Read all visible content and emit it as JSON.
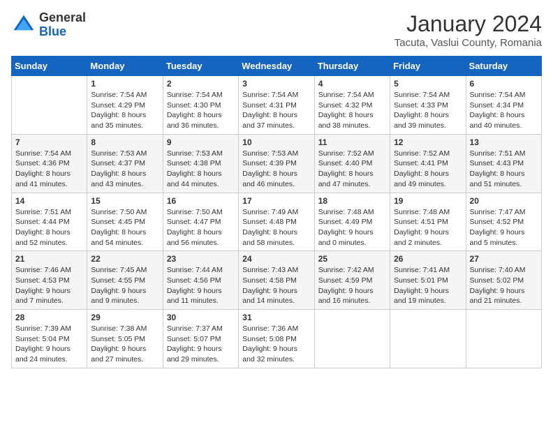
{
  "header": {
    "logo_general": "General",
    "logo_blue": "Blue",
    "month_title": "January 2024",
    "location": "Tacuta, Vaslui County, Romania"
  },
  "days_of_week": [
    "Sunday",
    "Monday",
    "Tuesday",
    "Wednesday",
    "Thursday",
    "Friday",
    "Saturday"
  ],
  "weeks": [
    [
      {
        "day": "",
        "detail": ""
      },
      {
        "day": "1",
        "detail": "Sunrise: 7:54 AM\nSunset: 4:29 PM\nDaylight: 8 hours\nand 35 minutes."
      },
      {
        "day": "2",
        "detail": "Sunrise: 7:54 AM\nSunset: 4:30 PM\nDaylight: 8 hours\nand 36 minutes."
      },
      {
        "day": "3",
        "detail": "Sunrise: 7:54 AM\nSunset: 4:31 PM\nDaylight: 8 hours\nand 37 minutes."
      },
      {
        "day": "4",
        "detail": "Sunrise: 7:54 AM\nSunset: 4:32 PM\nDaylight: 8 hours\nand 38 minutes."
      },
      {
        "day": "5",
        "detail": "Sunrise: 7:54 AM\nSunset: 4:33 PM\nDaylight: 8 hours\nand 39 minutes."
      },
      {
        "day": "6",
        "detail": "Sunrise: 7:54 AM\nSunset: 4:34 PM\nDaylight: 8 hours\nand 40 minutes."
      }
    ],
    [
      {
        "day": "7",
        "detail": "Sunrise: 7:54 AM\nSunset: 4:36 PM\nDaylight: 8 hours\nand 41 minutes."
      },
      {
        "day": "8",
        "detail": "Sunrise: 7:53 AM\nSunset: 4:37 PM\nDaylight: 8 hours\nand 43 minutes."
      },
      {
        "day": "9",
        "detail": "Sunrise: 7:53 AM\nSunset: 4:38 PM\nDaylight: 8 hours\nand 44 minutes."
      },
      {
        "day": "10",
        "detail": "Sunrise: 7:53 AM\nSunset: 4:39 PM\nDaylight: 8 hours\nand 46 minutes."
      },
      {
        "day": "11",
        "detail": "Sunrise: 7:52 AM\nSunset: 4:40 PM\nDaylight: 8 hours\nand 47 minutes."
      },
      {
        "day": "12",
        "detail": "Sunrise: 7:52 AM\nSunset: 4:41 PM\nDaylight: 8 hours\nand 49 minutes."
      },
      {
        "day": "13",
        "detail": "Sunrise: 7:51 AM\nSunset: 4:43 PM\nDaylight: 8 hours\nand 51 minutes."
      }
    ],
    [
      {
        "day": "14",
        "detail": "Sunrise: 7:51 AM\nSunset: 4:44 PM\nDaylight: 8 hours\nand 52 minutes."
      },
      {
        "day": "15",
        "detail": "Sunrise: 7:50 AM\nSunset: 4:45 PM\nDaylight: 8 hours\nand 54 minutes."
      },
      {
        "day": "16",
        "detail": "Sunrise: 7:50 AM\nSunset: 4:47 PM\nDaylight: 8 hours\nand 56 minutes."
      },
      {
        "day": "17",
        "detail": "Sunrise: 7:49 AM\nSunset: 4:48 PM\nDaylight: 8 hours\nand 58 minutes."
      },
      {
        "day": "18",
        "detail": "Sunrise: 7:48 AM\nSunset: 4:49 PM\nDaylight: 9 hours\nand 0 minutes."
      },
      {
        "day": "19",
        "detail": "Sunrise: 7:48 AM\nSunset: 4:51 PM\nDaylight: 9 hours\nand 2 minutes."
      },
      {
        "day": "20",
        "detail": "Sunrise: 7:47 AM\nSunset: 4:52 PM\nDaylight: 9 hours\nand 5 minutes."
      }
    ],
    [
      {
        "day": "21",
        "detail": "Sunrise: 7:46 AM\nSunset: 4:53 PM\nDaylight: 9 hours\nand 7 minutes."
      },
      {
        "day": "22",
        "detail": "Sunrise: 7:45 AM\nSunset: 4:55 PM\nDaylight: 9 hours\nand 9 minutes."
      },
      {
        "day": "23",
        "detail": "Sunrise: 7:44 AM\nSunset: 4:56 PM\nDaylight: 9 hours\nand 11 minutes."
      },
      {
        "day": "24",
        "detail": "Sunrise: 7:43 AM\nSunset: 4:58 PM\nDaylight: 9 hours\nand 14 minutes."
      },
      {
        "day": "25",
        "detail": "Sunrise: 7:42 AM\nSunset: 4:59 PM\nDaylight: 9 hours\nand 16 minutes."
      },
      {
        "day": "26",
        "detail": "Sunrise: 7:41 AM\nSunset: 5:01 PM\nDaylight: 9 hours\nand 19 minutes."
      },
      {
        "day": "27",
        "detail": "Sunrise: 7:40 AM\nSunset: 5:02 PM\nDaylight: 9 hours\nand 21 minutes."
      }
    ],
    [
      {
        "day": "28",
        "detail": "Sunrise: 7:39 AM\nSunset: 5:04 PM\nDaylight: 9 hours\nand 24 minutes."
      },
      {
        "day": "29",
        "detail": "Sunrise: 7:38 AM\nSunset: 5:05 PM\nDaylight: 9 hours\nand 27 minutes."
      },
      {
        "day": "30",
        "detail": "Sunrise: 7:37 AM\nSunset: 5:07 PM\nDaylight: 9 hours\nand 29 minutes."
      },
      {
        "day": "31",
        "detail": "Sunrise: 7:36 AM\nSunset: 5:08 PM\nDaylight: 9 hours\nand 32 minutes."
      },
      {
        "day": "",
        "detail": ""
      },
      {
        "day": "",
        "detail": ""
      },
      {
        "day": "",
        "detail": ""
      }
    ]
  ]
}
